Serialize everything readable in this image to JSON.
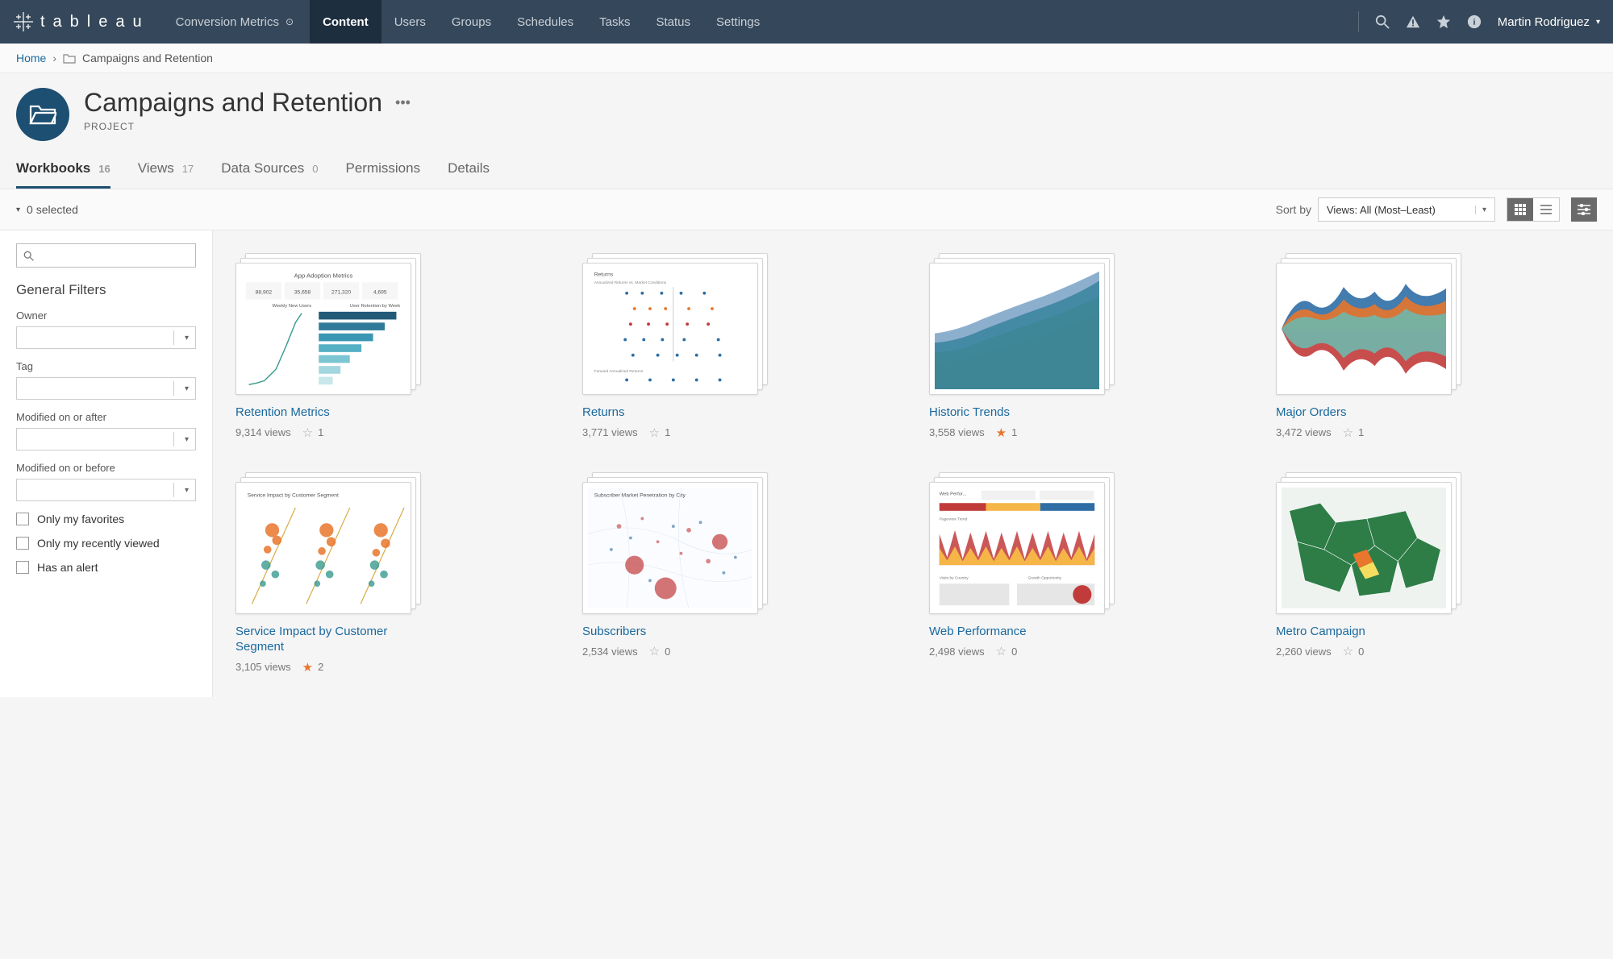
{
  "topnav": {
    "site_name": "Conversion Metrics",
    "items": [
      {
        "label": "Content",
        "active": true
      },
      {
        "label": "Users",
        "active": false
      },
      {
        "label": "Groups",
        "active": false
      },
      {
        "label": "Schedules",
        "active": false
      },
      {
        "label": "Tasks",
        "active": false
      },
      {
        "label": "Status",
        "active": false
      },
      {
        "label": "Settings",
        "active": false
      }
    ],
    "user_name": "Martin Rodriguez"
  },
  "breadcrumb": {
    "home": "Home",
    "current": "Campaigns and Retention"
  },
  "header": {
    "title": "Campaigns and Retention",
    "subtitle": "PROJECT"
  },
  "tabs": [
    {
      "label": "Workbooks",
      "count": "16",
      "active": true
    },
    {
      "label": "Views",
      "count": "17",
      "active": false
    },
    {
      "label": "Data Sources",
      "count": "0",
      "active": false
    },
    {
      "label": "Permissions",
      "count": "",
      "active": false
    },
    {
      "label": "Details",
      "count": "",
      "active": false
    }
  ],
  "toolbar": {
    "selected_text": "0 selected",
    "sort_label": "Sort by",
    "sort_value": "Views: All (Most–Least)"
  },
  "filters": {
    "section_title": "General Filters",
    "fields": [
      {
        "label": "Owner"
      },
      {
        "label": "Tag"
      },
      {
        "label": "Modified on or after"
      },
      {
        "label": "Modified on or before"
      }
    ],
    "checks": [
      {
        "label": "Only my favorites"
      },
      {
        "label": "Only my recently viewed"
      },
      {
        "label": "Has an alert"
      }
    ]
  },
  "workbooks": [
    {
      "title": "Retention Metrics",
      "views": "9,314 views",
      "fav_count": "1",
      "fav": false,
      "thumb": "retention"
    },
    {
      "title": "Returns",
      "views": "3,771 views",
      "fav_count": "1",
      "fav": false,
      "thumb": "returns"
    },
    {
      "title": "Historic Trends",
      "views": "3,558 views",
      "fav_count": "1",
      "fav": true,
      "thumb": "historic"
    },
    {
      "title": "Major Orders",
      "views": "3,472 views",
      "fav_count": "1",
      "fav": false,
      "thumb": "orders"
    },
    {
      "title": "Service Impact by Customer Segment",
      "views": "3,105 views",
      "fav_count": "2",
      "fav": true,
      "thumb": "service"
    },
    {
      "title": "Subscribers",
      "views": "2,534 views",
      "fav_count": "0",
      "fav": false,
      "thumb": "subscribers"
    },
    {
      "title": "Web Performance",
      "views": "2,498 views",
      "fav_count": "0",
      "fav": false,
      "thumb": "web"
    },
    {
      "title": "Metro Campaign",
      "views": "2,260 views",
      "fav_count": "0",
      "fav": false,
      "thumb": "metro"
    }
  ]
}
